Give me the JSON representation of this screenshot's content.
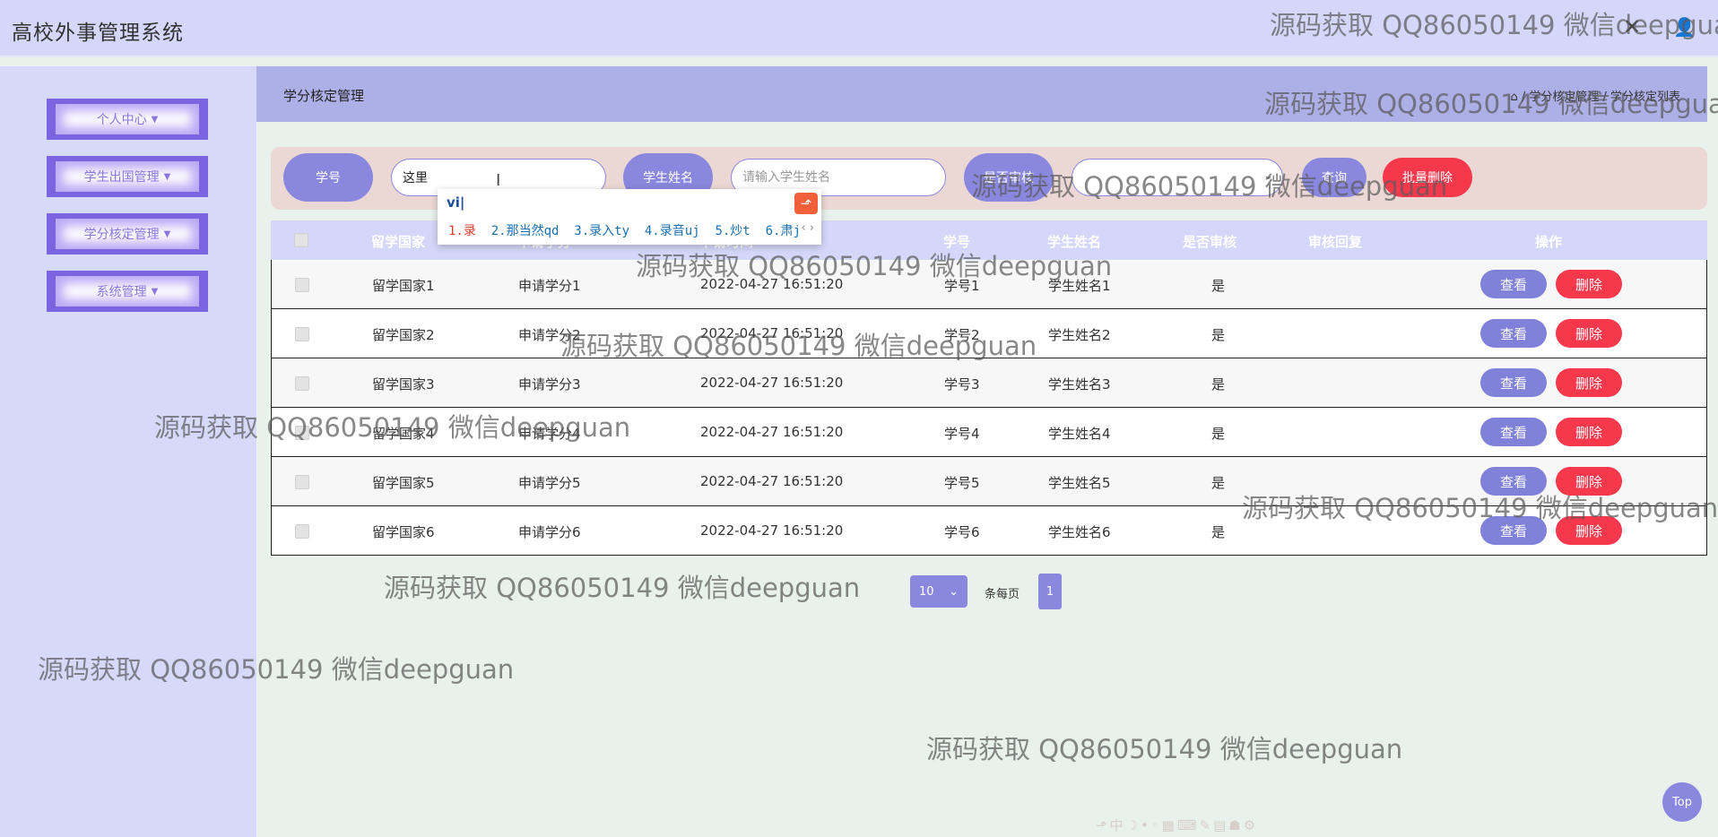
{
  "app": {
    "title": "高校外事管理系统",
    "close_icon_glyph": "✕",
    "user_icon_glyph": "👤"
  },
  "sidebar": {
    "items": [
      {
        "label": "个人中心"
      },
      {
        "label": "学生出国管理"
      },
      {
        "label": "学分核定管理"
      },
      {
        "label": "系统管理"
      }
    ]
  },
  "header": {
    "title": "学分核定管理",
    "breadcrumb": "⌂ / 学分核定管理 / 学分核定列表"
  },
  "search": {
    "label_xuehao": "学号",
    "input_xuehao_value": "这里",
    "label_name": "学生姓名",
    "input_name_placeholder": "请输入学生姓名",
    "label_review": "是否审核",
    "search_button": "查询",
    "batch_delete_button": "批量删除"
  },
  "ime": {
    "composition": "vi|",
    "candidates": [
      "1.录",
      "2.那当然qd",
      "3.录入ty",
      "4.录音uj",
      "5.炒t",
      "6.肃j"
    ],
    "nav": "‹ ›"
  },
  "table": {
    "headers": [
      "留学国家",
      "申请学分",
      "申请时间",
      "学号",
      "学生姓名",
      "是否审核",
      "审核回复",
      "操作"
    ],
    "view_label": "查看",
    "delete_label": "删除",
    "rows": [
      {
        "country": "留学国家1",
        "credit": "申请学分1",
        "time": "2022-04-27 16:51:20",
        "xuehao": "学号1",
        "name": "学生姓名1",
        "reviewed": "是",
        "reply": ""
      },
      {
        "country": "留学国家2",
        "credit": "申请学分2",
        "time": "2022-04-27 16:51:20",
        "xuehao": "学号2",
        "name": "学生姓名2",
        "reviewed": "是",
        "reply": ""
      },
      {
        "country": "留学国家3",
        "credit": "申请学分3",
        "time": "2022-04-27 16:51:20",
        "xuehao": "学号3",
        "name": "学生姓名3",
        "reviewed": "是",
        "reply": ""
      },
      {
        "country": "留学国家4",
        "credit": "申请学分4",
        "time": "2022-04-27 16:51:20",
        "xuehao": "学号4",
        "name": "学生姓名4",
        "reviewed": "是",
        "reply": ""
      },
      {
        "country": "留学国家5",
        "credit": "申请学分5",
        "time": "2022-04-27 16:51:20",
        "xuehao": "学号5",
        "name": "学生姓名5",
        "reviewed": "是",
        "reply": ""
      },
      {
        "country": "留学国家6",
        "credit": "申请学分6",
        "time": "2022-04-27 16:51:20",
        "xuehao": "学号6",
        "name": "学生姓名6",
        "reviewed": "是",
        "reply": ""
      }
    ]
  },
  "pagination": {
    "page_size": "10",
    "per_page_label": "条每页",
    "current_page": "1"
  },
  "back_to_top": "Top",
  "watermark": "源码获取 QQ86050149 微信deepguan"
}
